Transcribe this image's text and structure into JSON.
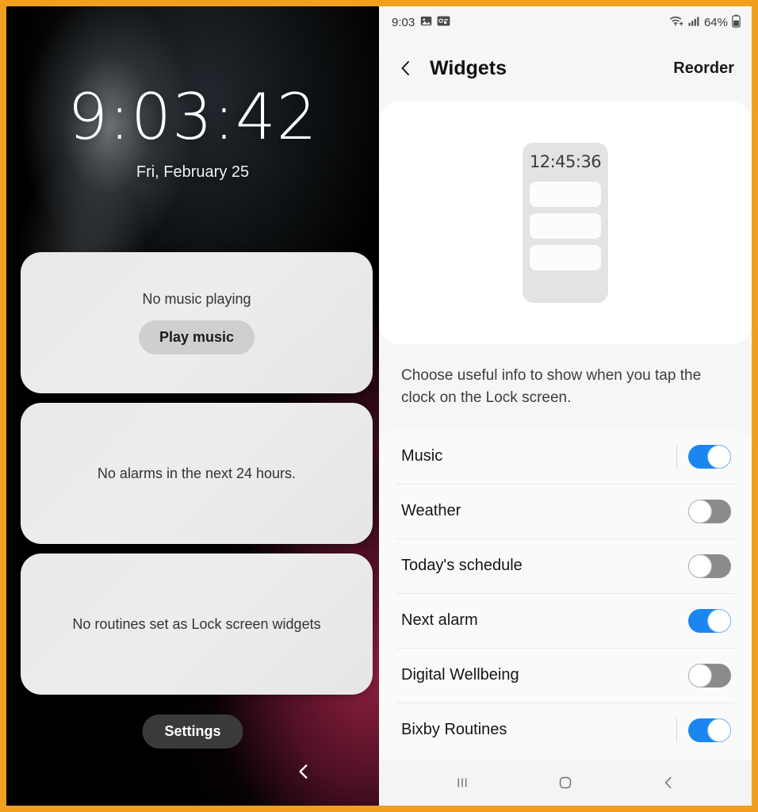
{
  "theme": {
    "border_color": "#f0a01e",
    "accent_on": "#1b86f0",
    "toggle_off": "#8b8b8b",
    "settings_bg": "#f6f6f6",
    "lock_bg": "#000000",
    "wallpaper_accent": "#962042"
  },
  "lockscreen": {
    "clock": "9:03:42",
    "date": "Fri, February 25",
    "cards": [
      {
        "name": "music",
        "text": "No music playing",
        "button": "Play music"
      },
      {
        "name": "alarm",
        "text": "No alarms in the next 24 hours."
      },
      {
        "name": "routines",
        "text": "No routines set as Lock screen widgets"
      }
    ],
    "settings_button": "Settings",
    "back_icon": "back-chevron-icon"
  },
  "settings": {
    "statusbar": {
      "time": "9:03",
      "left_icons": [
        "image-icon",
        "screenshot-icon"
      ],
      "right_icons": [
        "wifi-icon",
        "signal-icon"
      ],
      "battery_percent": "64%",
      "battery_icon": "battery-icon"
    },
    "appbar": {
      "back_icon": "back-chevron-icon",
      "title": "Widgets",
      "action": "Reorder"
    },
    "preview": {
      "clock": "12:45:36",
      "slot_count": 3
    },
    "description": "Choose useful info to show when you tap the clock on the Lock screen.",
    "items": [
      {
        "label": "Music",
        "state": "on",
        "divider": true
      },
      {
        "label": "Weather",
        "state": "off",
        "divider": false
      },
      {
        "label": "Today's schedule",
        "state": "off",
        "divider": false
      },
      {
        "label": "Next alarm",
        "state": "on",
        "divider": false
      },
      {
        "label": "Digital Wellbeing",
        "state": "off",
        "divider": false
      },
      {
        "label": "Bixby Routines",
        "state": "on",
        "divider": true
      }
    ],
    "navbar": {
      "recents": "recents-icon",
      "home": "home-icon",
      "back": "back-icon"
    }
  }
}
